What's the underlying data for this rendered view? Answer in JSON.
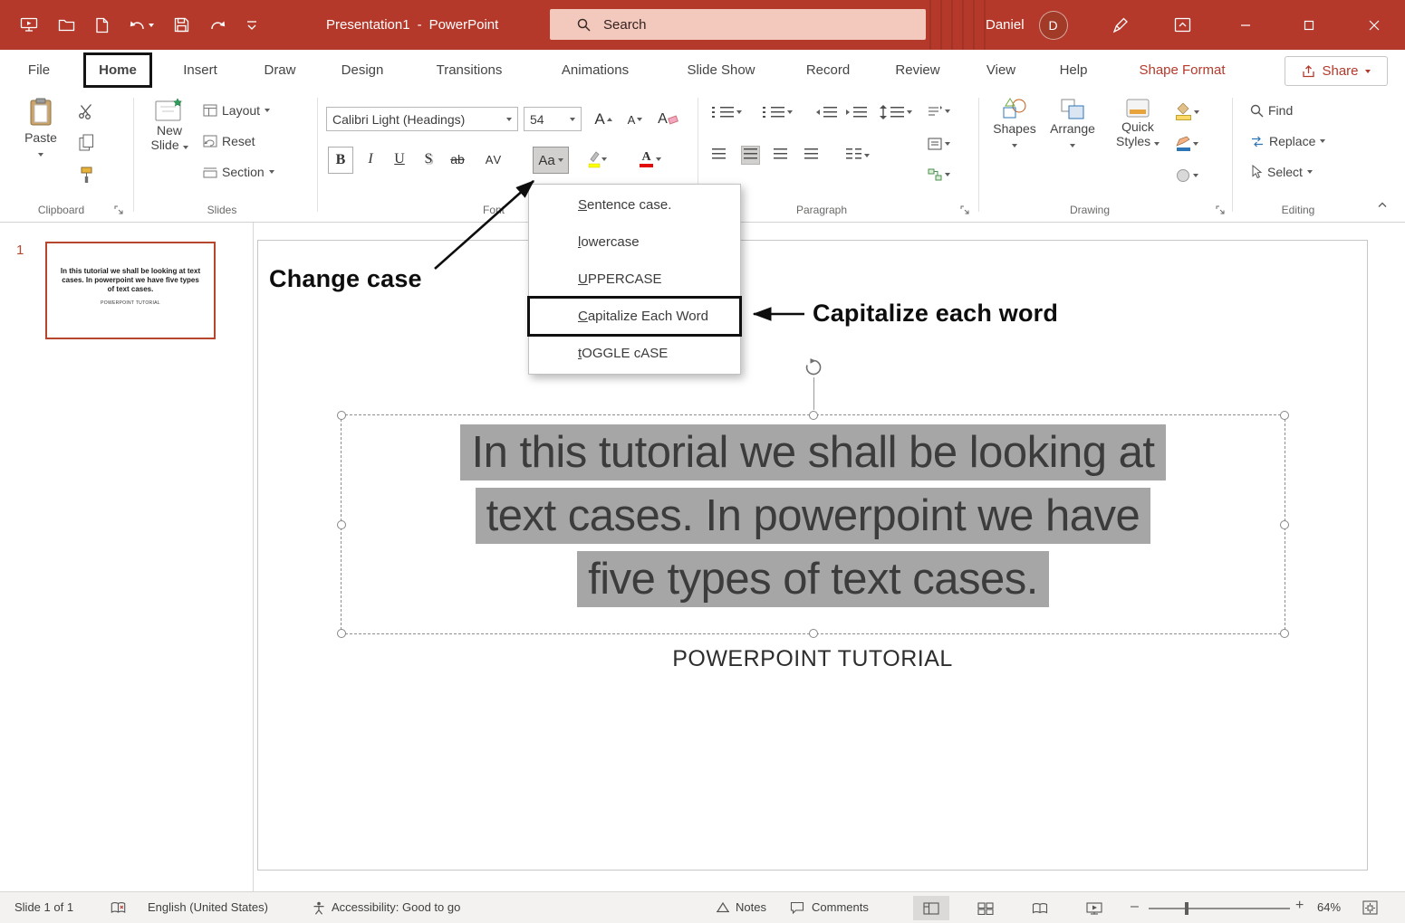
{
  "titlebar": {
    "doc": "Presentation1",
    "sep": "-",
    "app": "PowerPoint",
    "search": "Search",
    "user": "Daniel",
    "avatar": "D"
  },
  "tabs": {
    "file": "File",
    "home": "Home",
    "insert": "Insert",
    "draw": "Draw",
    "design": "Design",
    "transitions": "Transitions",
    "animations": "Animations",
    "slideshow": "Slide Show",
    "record": "Record",
    "review": "Review",
    "view": "View",
    "help": "Help",
    "shape_format": "Shape Format",
    "share": "Share"
  },
  "ribbon": {
    "clipboard": {
      "label": "Clipboard",
      "paste": "Paste"
    },
    "slides": {
      "label": "Slides",
      "new1": "New",
      "new2": "Slide",
      "layout": "Layout",
      "reset": "Reset",
      "section": "Section"
    },
    "font": {
      "label": "Font",
      "family": "Calibri Light (Headings)",
      "size": "54",
      "bold": "B",
      "italic": "I",
      "underline": "U",
      "shadow": "S",
      "strike": "ab",
      "spacing": "AV",
      "case": "Aa",
      "grow": "A",
      "shrink": "A",
      "clear": "A"
    },
    "paragraph": {
      "label": "Paragraph"
    },
    "drawing": {
      "label": "Drawing",
      "shapes": "Shapes",
      "arrange": "Arrange",
      "quick1": "Quick",
      "quick2": "Styles"
    },
    "editing": {
      "label": "Editing",
      "find": "Find",
      "replace": "Replace",
      "select": "Select"
    }
  },
  "case_menu": {
    "item0": "Sentence case.",
    "item1": "lowercase",
    "item2": "UPPERCASE",
    "item3": "Capitalize Each Word",
    "item4": "tOGGLE cASE"
  },
  "annotations": {
    "change_case": "Change case",
    "capitalize": "Capitalize each word"
  },
  "thumb": {
    "num": "1",
    "body": "In this tutorial we shall be looking at text cases. In powerpoint we have five types of text cases.",
    "subtitle": "POWERPOINT TUTORIAL"
  },
  "slide": {
    "line1": "In this tutorial we shall be looking at",
    "line2": "text cases. In powerpoint we have",
    "line3": "five types of text cases.",
    "subtitle": "POWERPOINT TUTORIAL"
  },
  "status": {
    "slide_info": "Slide 1 of 1",
    "language": "English (United States)",
    "accessibility": "Accessibility: Good to go",
    "notes": "Notes",
    "comments": "Comments",
    "zoom": "64%"
  },
  "colors": {
    "titlebar": "#b5392b",
    "accent": "#b6472f",
    "selection_gray": "#a6a6a6"
  }
}
